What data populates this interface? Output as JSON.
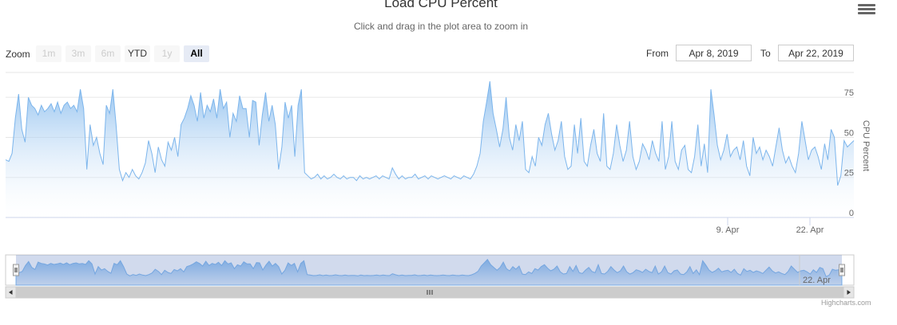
{
  "title": "Load CPU Percent",
  "subtitle": "Click and drag in the plot area to zoom in",
  "menu_icon": "hamburger-menu-icon",
  "range_selector": {
    "zoom_label": "Zoom",
    "buttons": [
      "1m",
      "3m",
      "6m",
      "YTD",
      "1y",
      "All"
    ],
    "enabled": [
      "YTD",
      "All"
    ],
    "selected": "All",
    "from_label": "From",
    "from_value": "Apr 8, 2019",
    "to_label": "To",
    "to_value": "Apr 22, 2019"
  },
  "credits": "Highcharts.com",
  "colors": {
    "line": "#7cb5ec",
    "fill_top": "#7cb5ec",
    "fill_bottom": "#ffffff",
    "navigator_mask": "#6685c2"
  },
  "chart_data": {
    "type": "area",
    "title": "Load CPU Percent",
    "subtitle": "Click and drag in the plot area to zoom in",
    "ylabel": "CPU Percent",
    "ylim": [
      0,
      90
    ],
    "yticks": [
      0,
      25,
      50,
      75
    ],
    "xticks": [
      "9. Apr",
      "22. Apr"
    ],
    "navigator_label": "22. Apr",
    "grid": true,
    "series": [
      {
        "values": [
          36,
          35,
          40,
          62,
          77,
          55,
          47,
          75,
          70,
          68,
          64,
          70,
          66,
          68,
          71,
          66,
          72,
          65,
          70,
          72,
          68,
          70,
          66,
          80,
          68,
          30,
          58,
          45,
          50,
          40,
          33,
          70,
          65,
          80,
          58,
          30,
          23,
          28,
          25,
          30,
          26,
          24,
          28,
          34,
          48,
          40,
          28,
          44,
          36,
          32,
          47,
          42,
          50,
          38,
          58,
          62,
          68,
          76,
          70,
          60,
          78,
          62,
          70,
          66,
          74,
          62,
          80,
          68,
          72,
          50,
          65,
          60,
          76,
          68,
          68,
          50,
          73,
          72,
          45,
          64,
          78,
          60,
          70,
          58,
          30,
          44,
          72,
          62,
          70,
          38,
          70,
          80,
          28,
          26,
          24,
          25,
          27,
          24,
          26,
          24,
          25,
          27,
          25,
          24,
          26,
          24,
          25,
          25,
          23,
          26,
          24,
          25,
          24,
          25,
          26,
          24,
          26,
          25,
          24,
          31,
          27,
          24,
          26,
          24,
          25,
          25,
          27,
          24,
          25,
          26,
          24,
          26,
          25,
          24,
          25,
          26,
          25,
          24,
          26,
          25,
          24,
          26,
          25,
          24,
          27,
          32,
          40,
          60,
          72,
          85,
          65,
          55,
          44,
          55,
          75,
          50,
          42,
          58,
          48,
          60,
          30,
          28,
          38,
          32,
          50,
          45,
          58,
          65,
          52,
          42,
          48,
          60,
          38,
          30,
          32,
          58,
          40,
          62,
          35,
          32,
          45,
          55,
          40,
          35,
          65,
          32,
          30,
          40,
          58,
          45,
          35,
          42,
          60,
          38,
          30,
          35,
          46,
          42,
          36,
          48,
          40,
          35,
          60,
          30,
          38,
          60,
          35,
          30,
          42,
          45,
          30,
          28,
          38,
          58,
          32,
          46,
          28,
          80,
          64,
          45,
          36,
          42,
          52,
          38,
          42,
          44,
          36,
          48,
          32,
          26,
          50,
          40,
          44,
          36,
          42,
          38,
          32,
          44,
          56,
          42,
          34,
          38,
          32,
          28,
          40,
          60,
          48,
          36,
          42,
          44,
          38,
          30,
          46,
          36,
          55,
          50,
          20,
          26,
          48,
          44,
          46,
          48
        ]
      }
    ]
  }
}
